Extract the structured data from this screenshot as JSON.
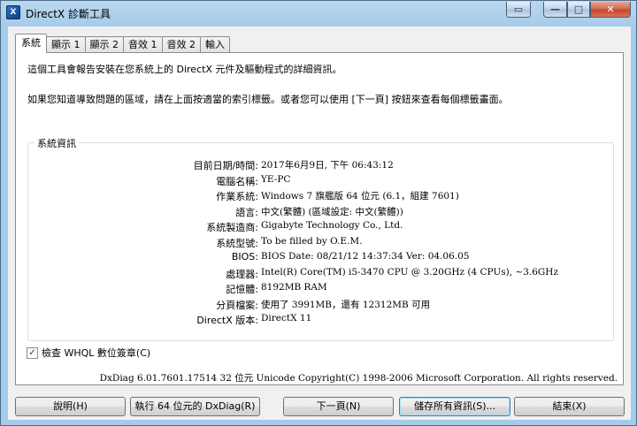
{
  "window": {
    "title": "DirectX 診斷工具",
    "icon_name": "directx-icon",
    "controls": {
      "extra": "▭",
      "minimize": "—",
      "maximize": "□",
      "close": "✕"
    }
  },
  "tabs": [
    {
      "label": "系統",
      "active": true
    },
    {
      "label": "顯示 1",
      "active": false
    },
    {
      "label": "顯示 2",
      "active": false
    },
    {
      "label": "音效 1",
      "active": false
    },
    {
      "label": "音效 2",
      "active": false
    },
    {
      "label": "輸入",
      "active": false
    }
  ],
  "intro": {
    "line1": "這個工具會報告安裝在您系統上的 DirectX 元件及驅動程式的詳細資訊。",
    "line2": "如果您知道導致問題的區域，請在上面按適當的索引標籤。或者您可以使用 [下一頁] 按鈕來查看每個標籤畫面。"
  },
  "system_info": {
    "group_title": "系統資訊",
    "rows": [
      {
        "label": "目前日期/時間:",
        "value": "2017年6月9日, 下午 06:43:12"
      },
      {
        "label": "電腦名稱:",
        "value": "YE-PC"
      },
      {
        "label": "作業系統:",
        "value": "Windows 7 旗艦版 64 位元 (6.1，組建 7601)"
      },
      {
        "label": "語言:",
        "value": "中文(繁體) (區域設定: 中文(繁體))"
      },
      {
        "label": "系統製造商:",
        "value": "Gigabyte Technology Co., Ltd."
      },
      {
        "label": "系統型號:",
        "value": "To be filled by O.E.M."
      },
      {
        "label": "BIOS:",
        "value": "BIOS Date: 08/21/12 14:37:34 Ver: 04.06.05"
      },
      {
        "label": "處理器:",
        "value": "Intel(R) Core(TM) i5-3470 CPU @ 3.20GHz (4 CPUs), ~3.6GHz"
      },
      {
        "label": "記憶體:",
        "value": "8192MB RAM"
      },
      {
        "label": "分頁檔案:",
        "value": "使用了 3991MB，還有 12312MB 可用"
      },
      {
        "label": "DirectX 版本:",
        "value": "DirectX 11"
      }
    ]
  },
  "whql_check": {
    "label": "檢查 WHQL 數位簽章(C)",
    "checked": true,
    "mark": "✓"
  },
  "footer": "DxDiag 6.01.7601.17514 32 位元 Unicode  Copyright(C) 1998-2006 Microsoft Corporation.  All rights reserved.",
  "buttons": {
    "help": "說明(H)",
    "run64": "執行 64 位元的 DxDiag(R)",
    "next": "下一頁(N)",
    "save": "儲存所有資訊(S)...",
    "exit": "結束(X)"
  }
}
